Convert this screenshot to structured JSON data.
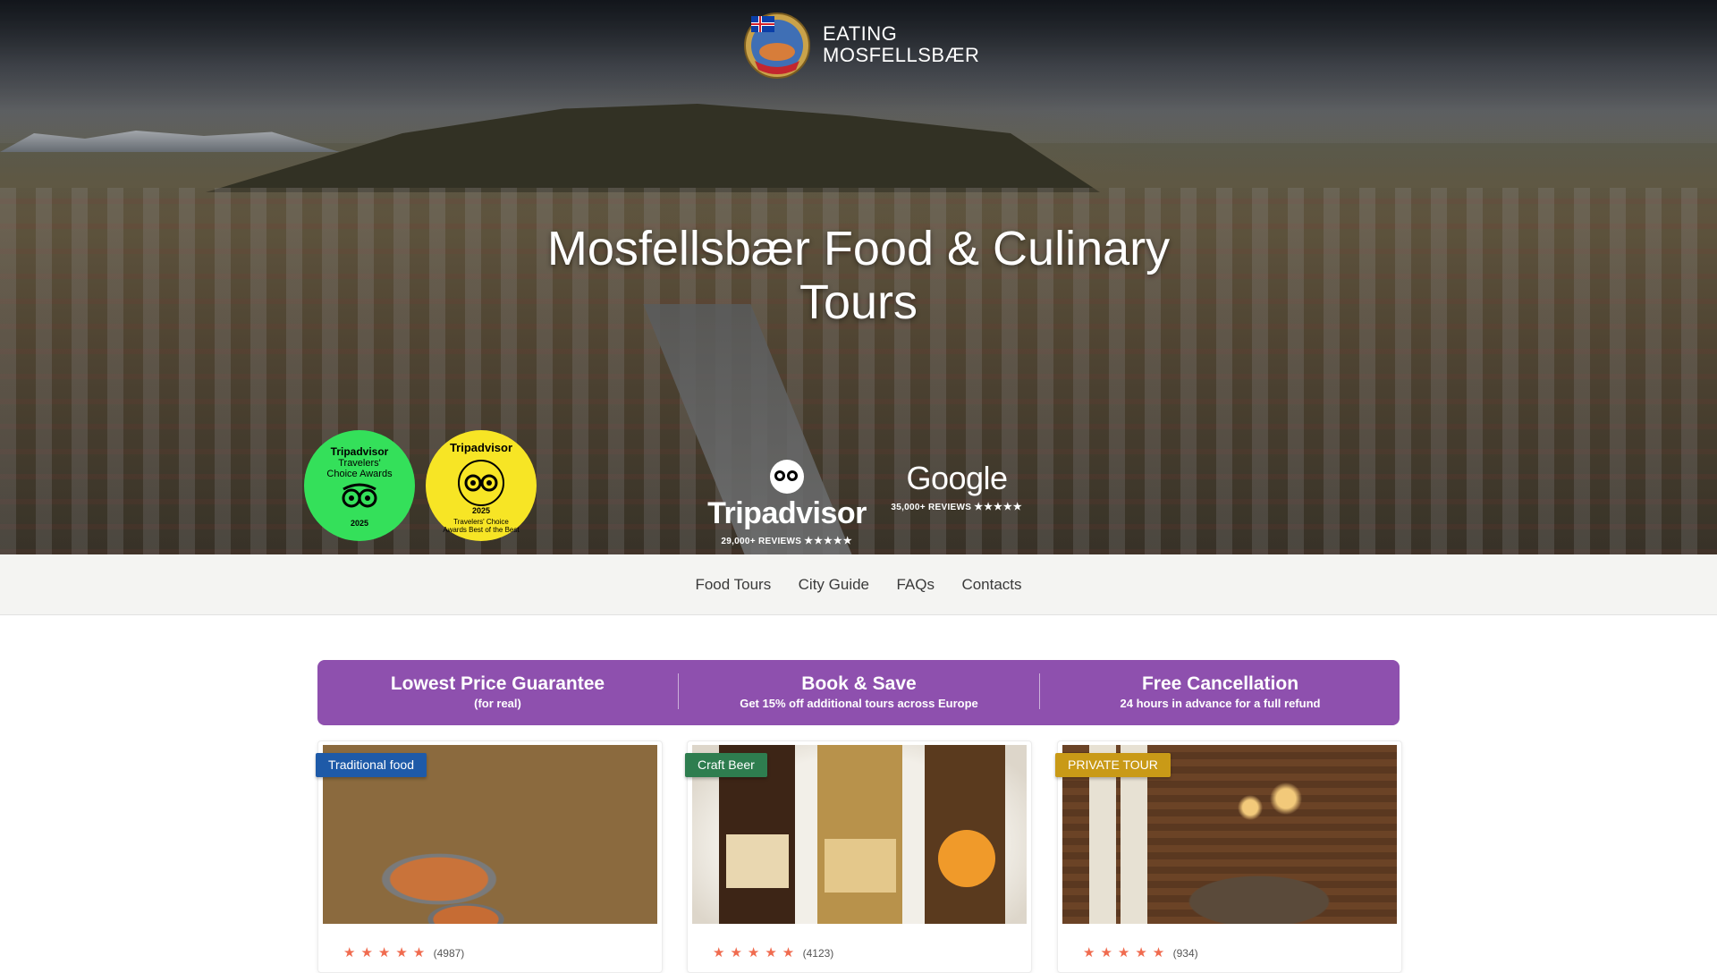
{
  "site": {
    "brand_line1": "EATING",
    "brand_line2": "MOSFELLSBÆR",
    "logo_icon": "iceland-food-tour-logo-icon"
  },
  "hero": {
    "title": "Mosfellsbær Food & Culinary Tours",
    "awards": [
      {
        "name": "Tripadvisor",
        "line2": "Travelers'",
        "line3": "Choice Awards",
        "year": "2025",
        "color": "#34e05a"
      },
      {
        "name": "Tripadvisor",
        "line2": "Travelers' Choice Awards Best of the Best",
        "year": "2025",
        "color": "#f7e525"
      }
    ],
    "reviews": [
      {
        "platform": "Tripadvisor",
        "count_text": "29,000+ REVIEWS",
        "stars": "★★★★★"
      },
      {
        "platform": "Google",
        "count_text": "35,000+ REVIEWS",
        "stars": "★★★★★"
      }
    ]
  },
  "nav": {
    "items": [
      "Food Tours",
      "City Guide",
      "FAQs",
      "Contacts"
    ]
  },
  "banner": {
    "color": "#8e50ae",
    "columns": [
      {
        "title": "Lowest Price Guarantee",
        "subtitle": "(for real)"
      },
      {
        "title": "Book & Save",
        "subtitle": "Get 15% off additional tours across Europe"
      },
      {
        "title": "Free Cancellation",
        "subtitle": "24 hours in advance for a full refund"
      }
    ]
  },
  "cards": [
    {
      "badge": "Traditional food",
      "badge_color": "#1e5aa8",
      "stars": "★★★★★",
      "reviews": "(4987)"
    },
    {
      "badge": "Craft Beer",
      "badge_color": "#2e7d4f",
      "stars": "★★★★★",
      "reviews": "(4123)"
    },
    {
      "badge": "PRIVATE TOUR",
      "badge_color": "#c99a17",
      "stars": "★★★★★",
      "reviews": "(934)"
    }
  ]
}
